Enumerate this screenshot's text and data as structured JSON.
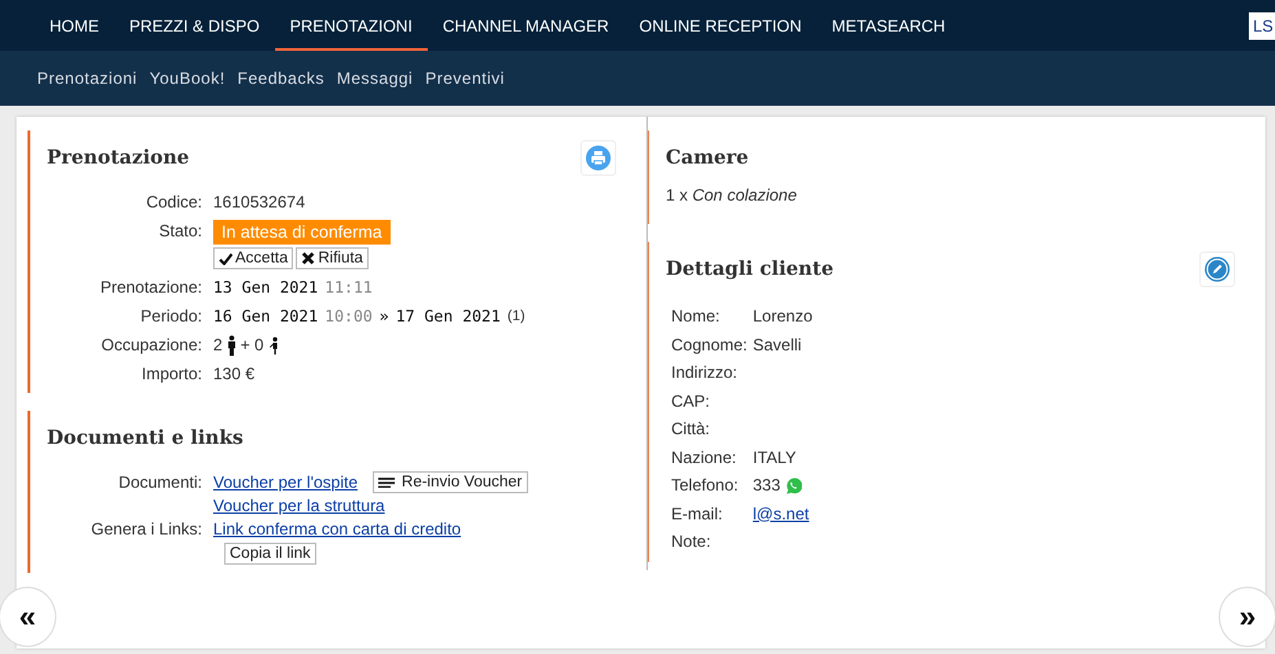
{
  "top_nav": [
    {
      "label": "HOME",
      "selected": false
    },
    {
      "label": "PREZZI & DISPO",
      "selected": false
    },
    {
      "label": "PRENOTAZIONI",
      "selected": true
    },
    {
      "label": "CHANNEL MANAGER",
      "selected": false
    },
    {
      "label": "ONLINE RECEPTION",
      "selected": false
    },
    {
      "label": "METASEARCH",
      "selected": false
    }
  ],
  "account_badge": "LS",
  "sub_nav": [
    "Prenotazioni",
    "YouBook!",
    "Feedbacks",
    "Messaggi",
    "Preventivi"
  ],
  "booking": {
    "title": "Prenotazione",
    "rows": [
      {
        "kind": "text",
        "label": "Codice:",
        "value": "1610532674"
      },
      {
        "kind": "status",
        "label": "Stato:",
        "value": "In attesa di conferma",
        "actions": [
          {
            "kind": "accept",
            "label": "Accetta"
          },
          {
            "kind": "reject",
            "label": "Rifiuta"
          }
        ]
      },
      {
        "kind": "datetime",
        "label": "Prenotazione:",
        "date": "13 Gen 2021",
        "time": "11:11"
      },
      {
        "kind": "period",
        "label": "Periodo:",
        "from_date": "16 Gen 2021",
        "from_time": "10:00",
        "separator": "»",
        "to_date": "17 Gen 2021",
        "nights": "(1)"
      },
      {
        "kind": "occupancy",
        "label": "Occupazione:",
        "adults": "2",
        "children": "+ 0"
      },
      {
        "kind": "text",
        "label": "Importo:",
        "value": "130 €"
      }
    ]
  },
  "documents": {
    "title": "Documenti e links",
    "rows": [
      {
        "label": "Documenti:",
        "link": "Voucher per l'ospite",
        "button": "Re-invio Voucher"
      },
      {
        "link": "Voucher per la struttura"
      },
      {
        "label": "Genera i Links:",
        "link": "Link conferma con carta di credito",
        "button_below": "Copia il link"
      }
    ]
  },
  "rooms": {
    "title": "Camere",
    "line": "1 x *Con colazione*"
  },
  "customer": {
    "title": "Dettagli cliente",
    "fields": [
      {
        "kind": "text",
        "label": "Nome:",
        "value": "Lorenzo"
      },
      {
        "kind": "text",
        "label": "Cognome:",
        "value": "Savelli"
      },
      {
        "label": "Indirizzo:"
      },
      {
        "label": "CAP:"
      },
      {
        "label": "Città:"
      },
      {
        "kind": "text",
        "label": "Nazione:",
        "value": "ITALY"
      },
      {
        "kind": "phone",
        "label": "Telefono:",
        "value": "333"
      },
      {
        "kind": "email",
        "label": "E-mail:",
        "value": "l@s.net"
      },
      {
        "label": "Note:"
      }
    ]
  },
  "pager": {
    "previous": "«",
    "next": "»"
  }
}
